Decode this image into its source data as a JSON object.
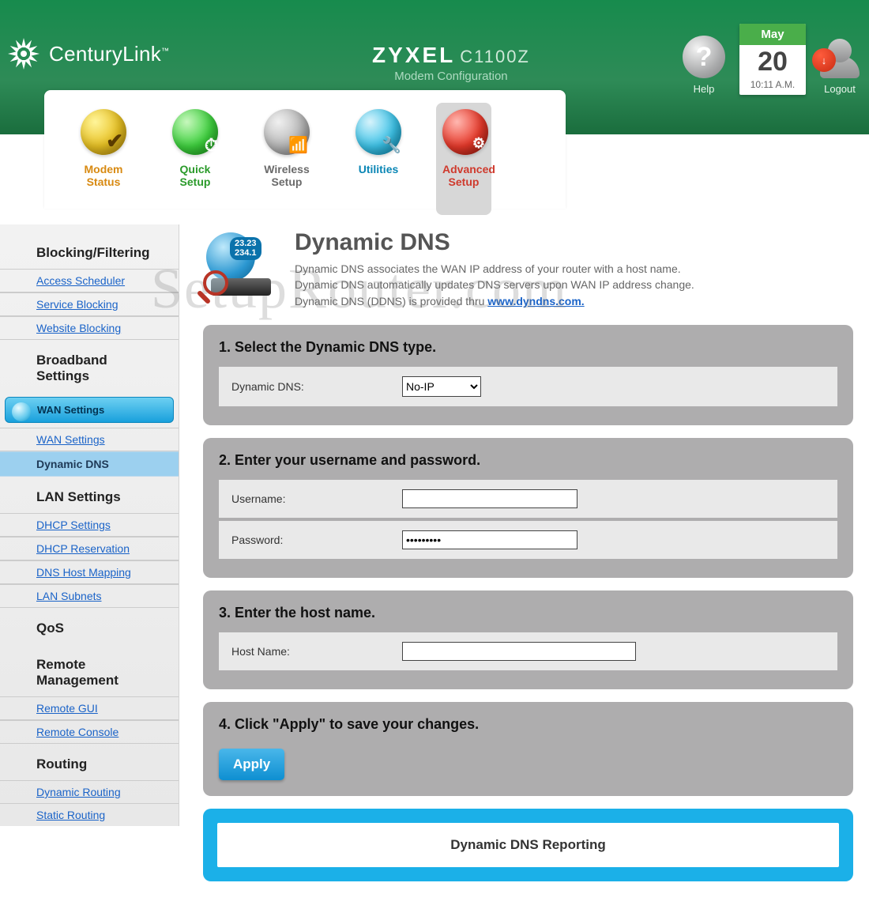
{
  "header": {
    "brand": "CenturyLink",
    "device_brand": "ZYXEL",
    "device_model": "C1100Z",
    "subtitle": "Modem Configuration",
    "help_label": "Help",
    "logout_label": "Logout",
    "calendar": {
      "month": "May",
      "day": "20",
      "time": "10:11 A.M."
    }
  },
  "tabs": [
    {
      "label_l1": "Modem",
      "label_l2": "Status",
      "color": "orange"
    },
    {
      "label_l1": "Quick",
      "label_l2": "Setup",
      "color": "green"
    },
    {
      "label_l1": "Wireless",
      "label_l2": "Setup",
      "color": "grey"
    },
    {
      "label_l1": "Utilities",
      "label_l2": "",
      "color": "blue"
    },
    {
      "label_l1": "Advanced",
      "label_l2": "Setup",
      "color": "red"
    }
  ],
  "sidebar": {
    "g1": "Blocking/Filtering",
    "g1_items": [
      "Access Scheduler",
      "Service Blocking",
      "Website Blocking"
    ],
    "g2": "Broadband Settings",
    "g3": "WAN Settings",
    "g3_items": [
      "WAN Settings",
      "Dynamic DNS"
    ],
    "g4": "LAN Settings",
    "g4_items": [
      "DHCP Settings",
      "DHCP Reservation",
      "DNS Host Mapping",
      "LAN Subnets"
    ],
    "g5": "QoS",
    "g6": "Remote Management",
    "g6_items": [
      "Remote GUI",
      "Remote Console"
    ],
    "g7": "Routing",
    "g7_items": [
      "Dynamic Routing",
      "Static Routing"
    ]
  },
  "page": {
    "title": "Dynamic DNS",
    "desc1": "Dynamic DNS associates the WAN IP address of your router with a host name.",
    "desc2": "Dynamic DNS automatically updates DNS servers upon WAN IP address change.",
    "desc3_pre": "Dynamic DNS (DDNS) is provided thru ",
    "link": "www.dyndns.com.",
    "icon_ip_l1": "23.23",
    "icon_ip_l2": "234.1"
  },
  "steps": {
    "s1": "1. Select the Dynamic DNS type.",
    "s1_label": "Dynamic DNS:",
    "s1_value": "No-IP",
    "s2": "2. Enter your username and password.",
    "s2_user_label": "Username:",
    "s2_user_value": "",
    "s2_pass_label": "Password:",
    "s2_pass_value": "•••••••••",
    "s3": "3. Enter the host name.",
    "s3_label": "Host Name:",
    "s3_value": "",
    "s4": "4. Click \"Apply\" to save your changes.",
    "apply": "Apply"
  },
  "report_title": "Dynamic DNS Reporting",
  "watermark": "SetupRouter.com"
}
